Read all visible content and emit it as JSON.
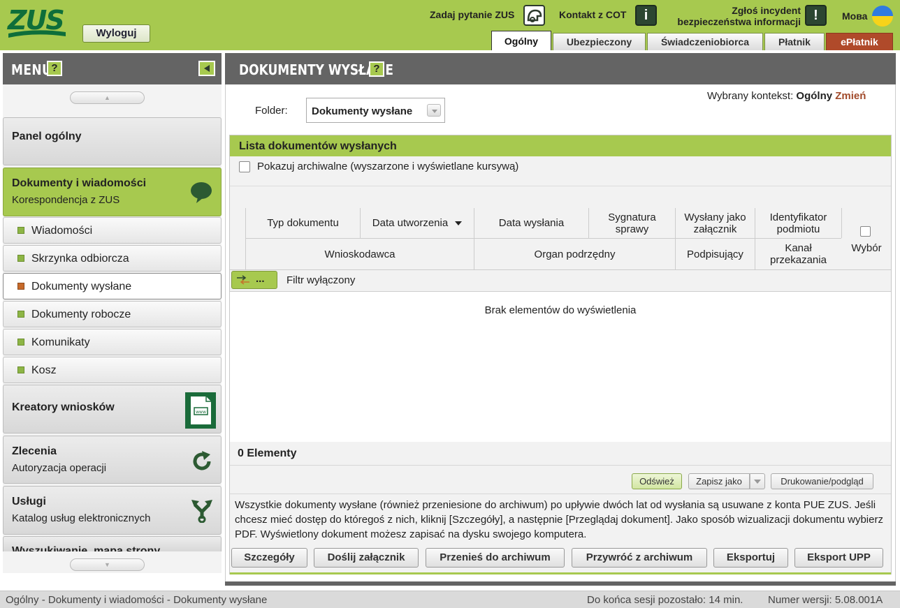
{
  "header": {
    "logout_label": "Wyloguj",
    "ask_zus_label": "Zadaj pytanie ZUS",
    "contact_cot_label": "Kontakt z COT",
    "report_incident_line1": "Zgłoś incydent",
    "report_incident_line2": "bezpieczeństwa informacji",
    "info_icon_glyph": "i",
    "alert_icon_glyph": "!",
    "language_label": "Мова",
    "tabs": [
      {
        "label": "Ogólny",
        "active": true
      },
      {
        "label": "Ubezpieczony"
      },
      {
        "label": "Świadczeniobiorca"
      },
      {
        "label": "Płatnik"
      },
      {
        "label": "ePłatnik"
      }
    ],
    "colors": {
      "brand_green": "#a7c94f",
      "dark_green": "#2c4631",
      "eplatnik": "#b04a2a"
    }
  },
  "sidebar": {
    "title": "MENU",
    "help_glyph": "?",
    "scroll_up_glyph": "▲",
    "scroll_down_glyph": "▼",
    "blocks": {
      "panel": {
        "title": "Panel ogólny"
      },
      "documents": {
        "title": "Dokumenty i wiadomości",
        "subtitle": "Korespondencja z ZUS",
        "icon": "speech-bubble-icon"
      },
      "creators": {
        "title": "Kreatory wniosków",
        "icon": "document-form-icon",
        "icon_text": "www"
      },
      "orders": {
        "title": "Zlecenia",
        "subtitle": "Autoryzacja operacji",
        "icon": "refresh-icon"
      },
      "services": {
        "title": "Usługi",
        "subtitle": "Katalog usług elektronicznych",
        "icon": "branch-arrows-icon"
      },
      "search": {
        "title": "Wyszukiwanie, mapa strony"
      }
    },
    "items": [
      {
        "label": "Wiadomości"
      },
      {
        "label": "Skrzynka odbiorcza"
      },
      {
        "label": "Dokumenty wysłane",
        "active": true
      },
      {
        "label": "Dokumenty robocze"
      },
      {
        "label": "Komunikaty"
      },
      {
        "label": "Kosz"
      }
    ]
  },
  "main": {
    "title": "DOKUMENTY WYSŁANE",
    "help_glyph": "?",
    "context_label": "Wybrany kontekst:",
    "context_value": "Ogólny",
    "context_change": "Zmień",
    "folder_label": "Folder:",
    "folder_value": "Dokumenty wysłane",
    "list": {
      "title": "Lista dokumentów wysłanych",
      "archive_checkbox_label": "Pokazuj archiwalne (wyszarzone i wyświetlane kursywą)",
      "columns_row1": [
        "Typ dokumentu",
        "Data utworzenia",
        "Data wysłania",
        "Sygnatura sprawy",
        "Wysłany jako załącznik",
        "Identyfikator podmiotu"
      ],
      "columns_row2": [
        "Wnioskodawca",
        "Organ podrzędny",
        "Podpisujący",
        "Kanał przekazania"
      ],
      "select_label": "Wybór",
      "filter_button_label": "...",
      "filter_status": "Filtr wyłączony",
      "empty_message": "Brak elementów do wyświetlenia",
      "count_label": "0 Elementy",
      "refresh_label": "Odśwież",
      "save_as_label": "Zapisz jako",
      "print_label": "Drukowanie/podgląd",
      "info_text": "Wszystkie dokumenty wysłane (również przeniesione do archiwum) po upływie dwóch lat od wysłania są usuwane z konta PUE ZUS. Jeśli chcesz mieć dostęp do któregoś z nich, kliknij [Szczegóły], a następnie [Przeglądaj dokument]. Jako sposób wizualizacji dokumentu wybierz PDF. Wyświetlony dokument możesz zapisać na dysku swojego komputera.",
      "actions": [
        "Szczegóły",
        "Doślij załącznik",
        "Przenieś do archiwum",
        "Przywróć z archiwum",
        "Eksportuj",
        "Eksport UPP"
      ]
    }
  },
  "statusbar": {
    "breadcrumb": "Ogólny - Dokumenty i wiadomości - Dokumenty wysłane",
    "session": "Do końca sesji pozostało: 14 min.",
    "version": "Numer wersji: 5.08.001A"
  }
}
